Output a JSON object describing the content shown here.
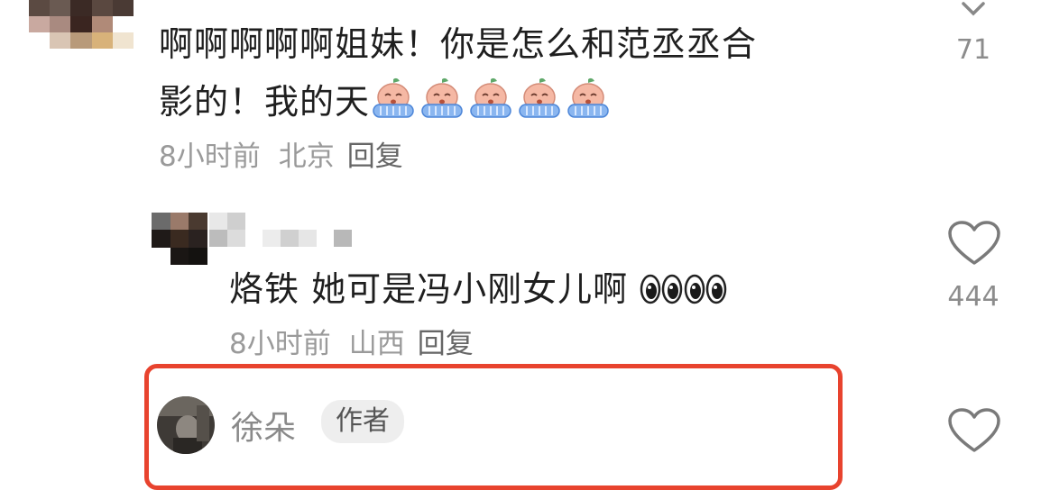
{
  "comments": [
    {
      "text": "啊啊啊啊啊姐妹！你是怎么和范丞丞合",
      "text_line2": "影的！我的天",
      "emoji_name": "crying-peach-emoji",
      "emoji_count": 5,
      "time": "8小时前",
      "location": "北京",
      "reply": "回复",
      "likes": "71"
    },
    {
      "text": "烙铁 她可是冯小刚女儿啊",
      "emoji_name": "eyes-emoji",
      "time": "8小时前",
      "location": "山西",
      "reply": "回复",
      "likes": "444"
    }
  ],
  "author_comment": {
    "name": "徐朵",
    "tag": "作者"
  },
  "colors": {
    "highlight": "#e8432e",
    "meta_text": "#9a9a9a",
    "body_text": "#1f1f1f"
  },
  "icons": [
    "heart-outline-icon",
    "chevron-icon",
    "avatar"
  ]
}
